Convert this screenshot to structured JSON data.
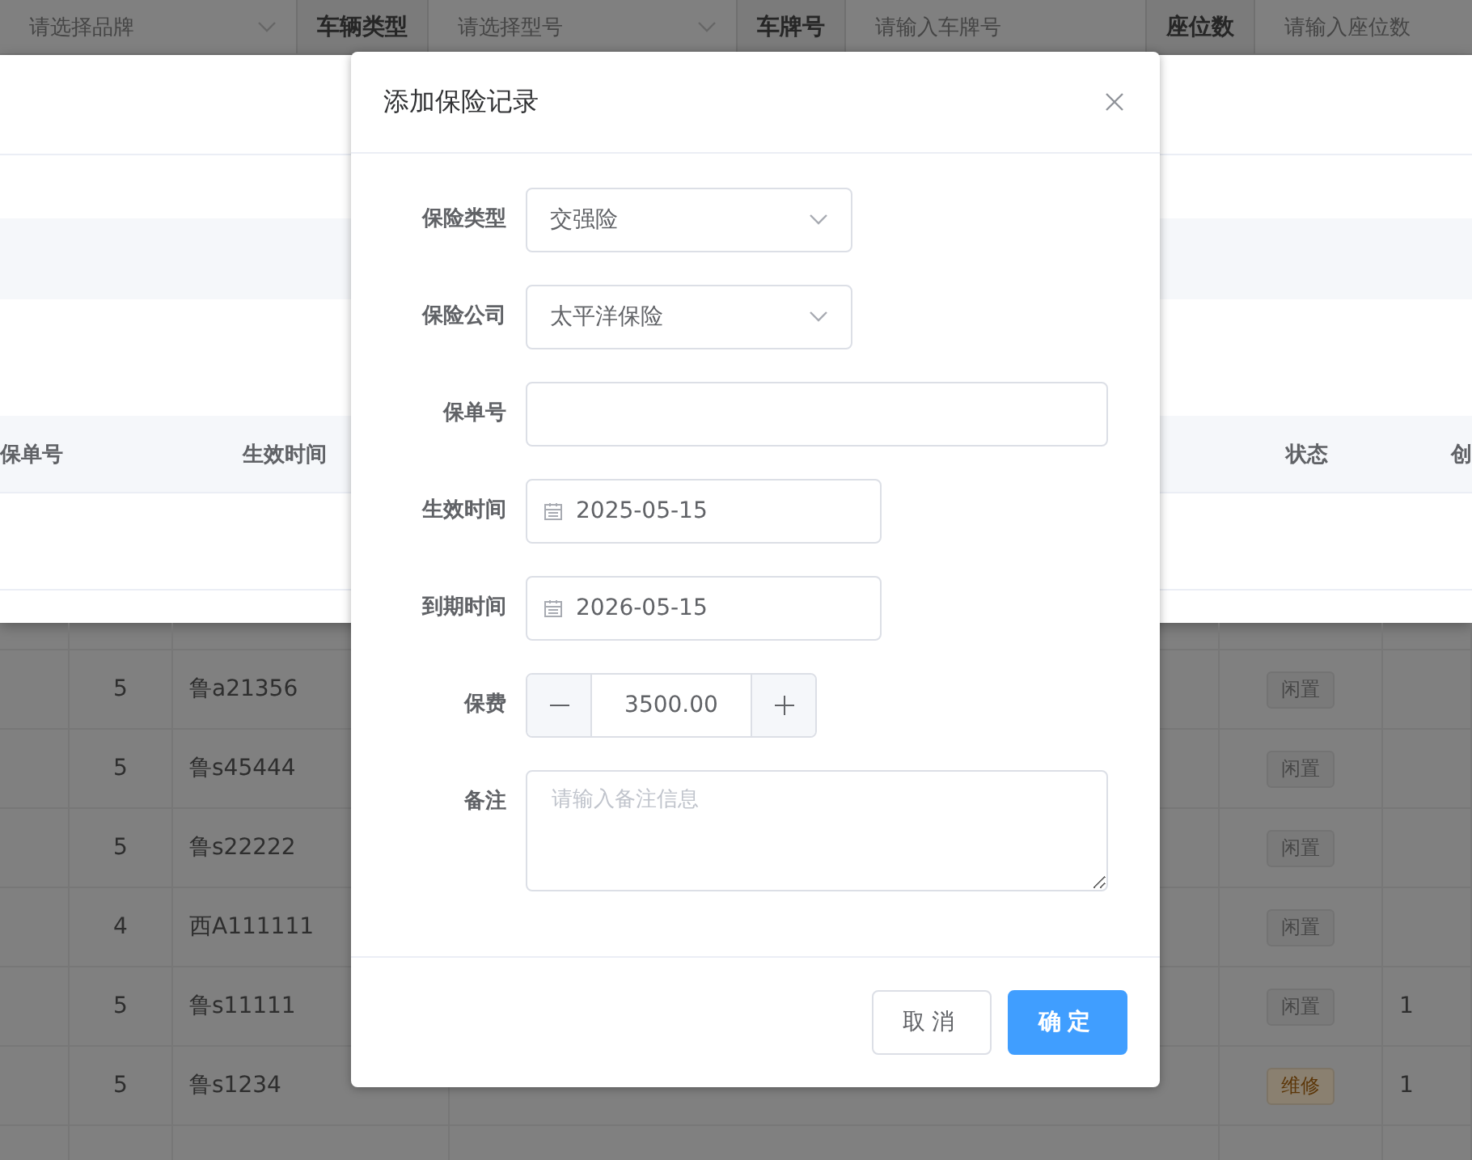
{
  "filter_bar": {
    "fields": [
      {
        "kind": "select",
        "placeholder": "请选择品牌"
      },
      {
        "kind": "select",
        "label": "车辆类型",
        "placeholder": "请选择型号"
      },
      {
        "kind": "input",
        "label": "车牌号",
        "placeholder": "请输入车牌号"
      },
      {
        "kind": "input",
        "label": "座位数",
        "placeholder": "请输入座位数"
      }
    ]
  },
  "insurance_list": {
    "columns": [
      "保单号",
      "生效时间",
      "状态",
      "创"
    ]
  },
  "vehicle_table": {
    "rows": [
      {
        "seats": "5",
        "plate": "鲁a21356",
        "status": {
          "label": "闲置",
          "kind": "idle"
        }
      },
      {
        "seats": "5",
        "plate": "鲁s45444",
        "status": {
          "label": "闲置",
          "kind": "idle"
        }
      },
      {
        "seats": "5",
        "plate": "鲁s22222",
        "status": {
          "label": "闲置",
          "kind": "idle"
        }
      },
      {
        "seats": "4",
        "plate": "西A111111",
        "status": {
          "label": "闲置",
          "kind": "idle"
        }
      },
      {
        "seats": "5",
        "plate": "鲁s11111",
        "status": {
          "label": "闲置",
          "kind": "idle"
        },
        "column_last": "1"
      },
      {
        "seats": "5",
        "plate": "鲁s1234",
        "status": {
          "label": "维修",
          "kind": "repair"
        },
        "column_last": "1"
      }
    ]
  },
  "dialog": {
    "title": "添加保险记录",
    "fields": [
      {
        "kind": "select",
        "label": "保险类型",
        "value": "交强险"
      },
      {
        "kind": "select",
        "label": "保险公司",
        "value": "太平洋保险"
      },
      {
        "kind": "input",
        "label": "保单号"
      },
      {
        "kind": "date",
        "label": "生效时间",
        "value": "2025-05-15"
      },
      {
        "kind": "date",
        "label": "到期时间",
        "value": "2026-05-15"
      },
      {
        "kind": "number",
        "label": "保费",
        "value": "3500.00"
      },
      {
        "kind": "textarea",
        "label": "备注",
        "placeholder": "请输入备注信息"
      }
    ],
    "buttons": [
      {
        "label": "取消",
        "kind": "default"
      },
      {
        "label": "确定",
        "kind": "primary"
      }
    ]
  }
}
